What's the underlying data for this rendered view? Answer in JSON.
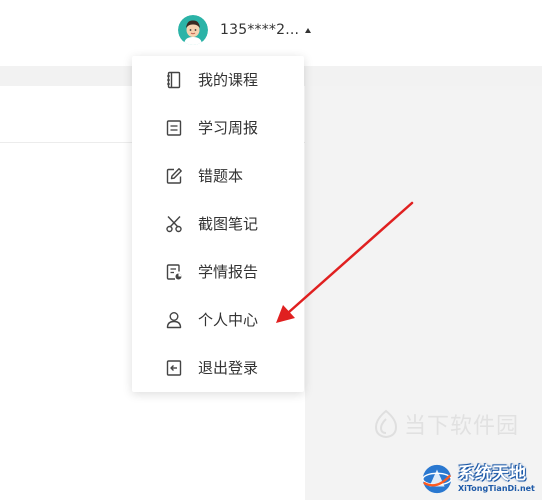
{
  "header": {
    "user_name": "135****2...",
    "avatar_icon": "user-avatar-cartoon",
    "dropdown_caret_icon": "caret-up-icon"
  },
  "menu": {
    "items": [
      {
        "label": "我的课程",
        "icon": "notebook-icon"
      },
      {
        "label": "学习周报",
        "icon": "document-lines-icon"
      },
      {
        "label": "错题本",
        "icon": "edit-icon"
      },
      {
        "label": "截图笔记",
        "icon": "scissors-icon"
      },
      {
        "label": "学情报告",
        "icon": "report-chart-icon"
      },
      {
        "label": "个人中心",
        "icon": "user-icon"
      },
      {
        "label": "退出登录",
        "icon": "logout-icon"
      }
    ]
  },
  "annotation": {
    "arrow_color": "#e02020"
  },
  "watermarks": {
    "site1": "当下软件园",
    "site2_cn": "系统天地",
    "site2_en": "XiTongTianDi.net"
  }
}
